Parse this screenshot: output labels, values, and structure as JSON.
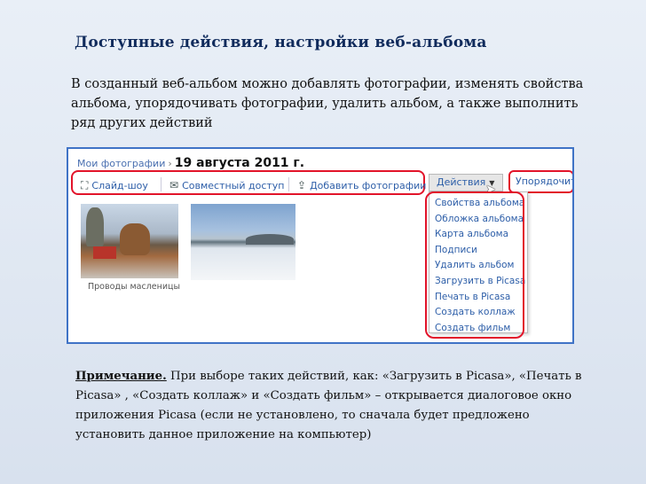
{
  "slide": {
    "title": "Доступные действия, настройки веб-альбома",
    "intro": "В созданный веб-альбом можно добавлять фотографии, изменять свойства альбома, упорядочивать фотографии, удалить альбом, а также выполнить ряд других действий"
  },
  "screenshot": {
    "breadcrumb": {
      "root": "Мои фотографии",
      "separator": "›",
      "current": "19 августа 2011 г."
    },
    "toolbar": {
      "slideshow": "Слайд-шоу",
      "sharing": "Совместный доступ",
      "add_photos": "Добавить фотографии",
      "actions": "Действия",
      "sort": "Упорядочить"
    },
    "actions_menu": [
      "Свойства альбома",
      "Обложка альбома",
      "Карта альбома",
      "Подписи",
      "Удалить альбом",
      "Загрузить в Picasa",
      "Печать в Picasa",
      "Создать коллаж",
      "Создать фильм"
    ],
    "photo_caption": "Проводы масленицы",
    "icons": {
      "slideshow": "fullscreen-icon",
      "sharing": "envelope-icon",
      "add": "upload-icon",
      "caret": "caret-down-icon",
      "cursor": "cursor-icon"
    }
  },
  "note": {
    "label": "Примечание.",
    "text": " При выборе таких действий, как: «Загрузить в Picasa», «Печать в Picasa» , «Создать коллаж» и «Создать фильм» – открывается диалоговое окно приложения Picasa (если не установлено, то  сначала будет предложено установить данное приложение на компьютер)"
  },
  "colors": {
    "title": "#102b5c",
    "highlight": "#e2142a",
    "frame": "#3f73c6",
    "link": "#2d5ea8"
  }
}
